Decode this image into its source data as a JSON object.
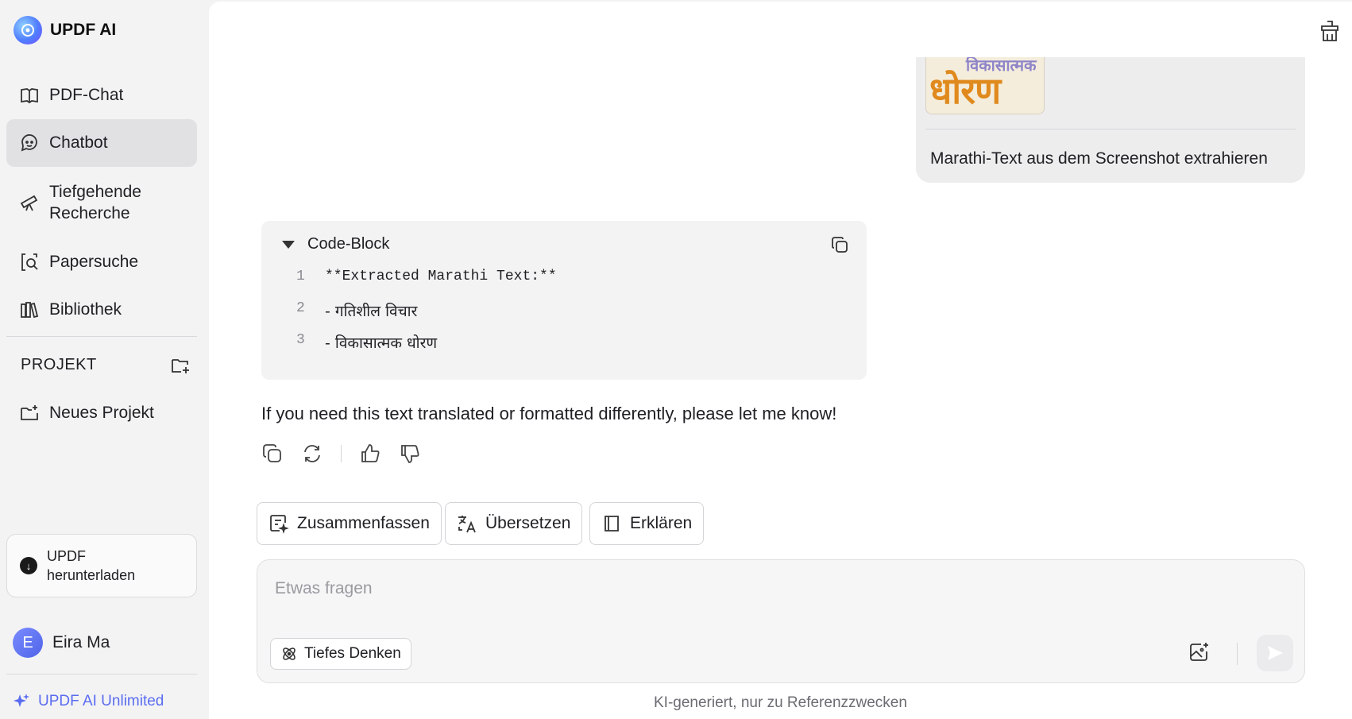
{
  "app": {
    "name": "UPDF AI"
  },
  "sidebar": {
    "items": [
      {
        "label": "PDF-Chat",
        "icon": "book-open-icon"
      },
      {
        "label": "Chatbot",
        "icon": "chatbot-icon",
        "active": true
      },
      {
        "label": "Tiefgehende Recherche",
        "icon": "telescope-icon"
      },
      {
        "label": "Papersuche",
        "icon": "paper-search-icon"
      },
      {
        "label": "Bibliothek",
        "icon": "library-icon"
      }
    ],
    "project_section": "PROJEKT",
    "new_project": "Neues Projekt",
    "download": "UPDF herunterladen",
    "user": {
      "initial": "E",
      "name": "Eira Ma"
    },
    "plan": "UPDF AI Unlimited"
  },
  "conversation": {
    "user_message": {
      "thumbnail_text_small": "विकासात्मक",
      "thumbnail_text_big": "धोरण",
      "text": "Marathi-Text aus dem Screenshot extrahieren"
    },
    "code_block": {
      "title": "Code-Block",
      "lines": [
        {
          "n": "1",
          "text": "**Extracted Marathi Text:**"
        },
        {
          "n": "2",
          "text": "- गतिशील विचार"
        },
        {
          "n": "3",
          "text": "- विकासात्मक धोरण"
        }
      ]
    },
    "response_text": "If you need this text translated or formatted differently, please let me know!"
  },
  "quick_actions": [
    "Zusammenfassen",
    "Übersetzen",
    "Erklären"
  ],
  "composer": {
    "placeholder": "Etwas fragen",
    "value": "",
    "deep_think": "Tiefes Denken"
  },
  "footer_note": "KI-generiert, nur zu Referenzzwecken",
  "colors": {
    "accent": "#5a6cf0",
    "sidebar_bg": "#f3f3f4",
    "active_item_bg": "#e1e1e4"
  }
}
